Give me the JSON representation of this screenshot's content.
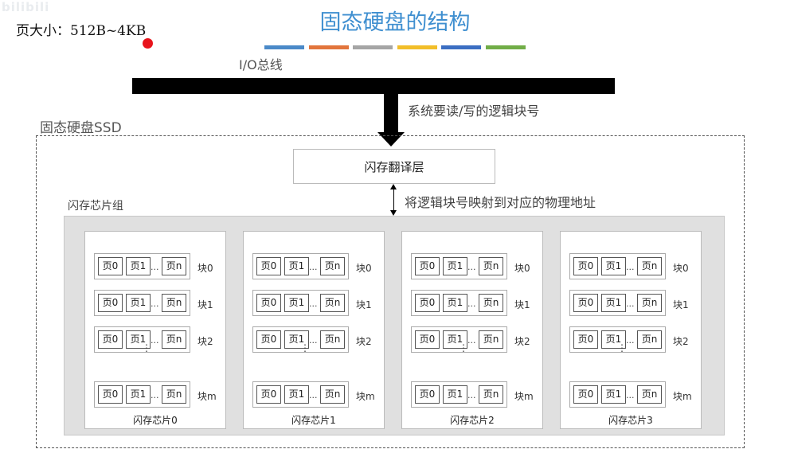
{
  "watermark": "bilibili",
  "title": "固态硬盘的结构",
  "page_size_note": "页大小：512B~4KB",
  "color_bar": [
    "#4a89c8",
    "#e2753c",
    "#a5a5a5",
    "#f2be29",
    "#3b6ec2",
    "#71ad47"
  ],
  "io_bus_label": "I/O总线",
  "request_label": "系统要读/写的逻辑块号",
  "ssd_label": "固态硬盘SSD",
  "ftl_label": "闪存翻译层",
  "mapping_label": "将逻辑块号映射到对应的物理地址",
  "chip_group_label": "闪存芯片组",
  "page_labels": [
    "页0",
    "页1",
    "页n"
  ],
  "page_ellipsis": "...",
  "block_labels": [
    "块0",
    "块1",
    "块2",
    "块m"
  ],
  "vertical_ellipsis": "⋮",
  "chips": [
    "闪存芯片0",
    "闪存芯片1",
    "闪存芯片2",
    "闪存芯片3"
  ]
}
